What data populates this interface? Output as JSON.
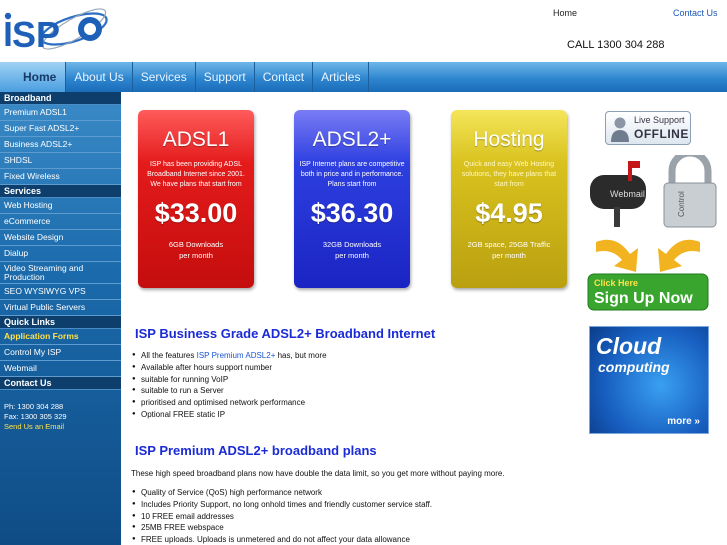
{
  "header": {
    "logo_text": "iSPO",
    "links": {
      "home": "Home",
      "contact": "Contact Us"
    },
    "call": "CALL 1300 304 288"
  },
  "nav": {
    "items": [
      "Home",
      "About Us",
      "Services",
      "Support",
      "Contact",
      "Articles"
    ]
  },
  "sidebar": {
    "broadband_heading": "Broadband",
    "broadband_items": [
      "Premium ADSL1",
      "Super Fast ADSL2+",
      "Business ADSL2+",
      "SHDSL",
      "Fixed Wireless"
    ],
    "services_heading": "Services",
    "services_items": [
      "Web Hosting",
      "eCommerce",
      "Website Design",
      "Dialup",
      "Video Streaming and Production",
      "SEO WYSIWYG VPS",
      "Virtual Public Servers"
    ],
    "quicklinks_heading": "Quick Links",
    "quicklinks_items": [
      "Application Forms",
      "Control My ISP",
      "Webmail"
    ],
    "contact_heading": "Contact Us",
    "phone": "Ph: 1300 304 288",
    "fax": "Fax: 1300 305 329",
    "email": "Send Us an Email"
  },
  "cards": {
    "adsl1": {
      "title": "ADSL1",
      "desc": "ISP has been providing ADSL Broadband Internet since 2001. We have plans that start from",
      "price": "$33.00",
      "feature": "6GB Downloads",
      "period": "per month"
    },
    "adsl2": {
      "title": "ADSL2+",
      "desc": "ISP Internet plans are competitive both in price and in performance. Plans start from",
      "price": "$36.30",
      "feature": "32GB Downloads",
      "period": "per month"
    },
    "hosting": {
      "title": "Hosting",
      "desc": "Quick and easy Web Hosting solutions, they have plans that start from",
      "price": "$4.95",
      "feature": "2GB space, 25GB Traffic",
      "period": "per month"
    }
  },
  "main": {
    "heading1": "ISP Business Grade ADSL2+ Broadband Internet",
    "bullets1": {
      "first_prefix": "All the features ",
      "first_link": "ISP Premium ADSL2+",
      "first_suffix": " has, but more",
      "rest": [
        "Available after hours support number",
        "suitable for running VoIP",
        "suitable to run a Server",
        "prioritised and optimised network performance",
        "Optional FREE static IP"
      ]
    },
    "heading2": "ISP Premium ADSL2+ broadband plans",
    "intro": "These high speed broadband plans now have double the data limit, so you get more without paying more.",
    "bullets2": [
      "Quality of Service (QoS) high performance network",
      "Includes Priority Support, no long onhold times and friendly customer service staff.",
      "10 FREE email addresses",
      "25MB FREE webspace",
      "FREE uploads. Uploads is unmetered and do not affect your data allowance"
    ]
  },
  "right": {
    "live_support_label": "Live Support",
    "live_support_status": "OFFLINE",
    "webmail_label": "Webmail",
    "control_label": "Control",
    "signup_small": "Click Here",
    "signup_big": "Sign Up Now",
    "cloud_title": "Cloud",
    "cloud_sub": "computing",
    "cloud_more": "more »"
  },
  "colors": {
    "nav_blue": "#2e86cf",
    "heading_blue": "#1a2bd6",
    "adsl1_red": "#e41b1b",
    "adsl2_blue": "#2d3fe0",
    "hosting_yellow": "#d9c21e"
  }
}
